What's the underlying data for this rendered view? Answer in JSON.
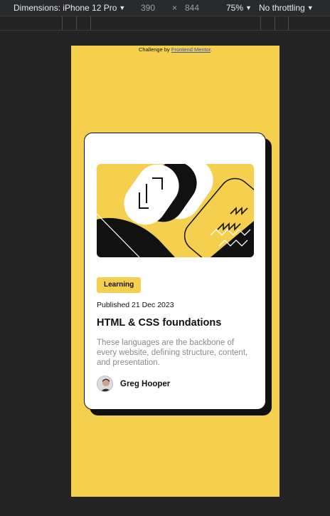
{
  "devtools": {
    "dimensions_label": "Dimensions: iPhone 12 Pro",
    "width": "390",
    "times": "×",
    "height": "844",
    "zoom": "75%",
    "throttling": "No throttling"
  },
  "attribution": {
    "prefix": "Challenge by",
    "link": "Frontend Mentor",
    "suffix": "."
  },
  "card": {
    "tag": "Learning",
    "published": "Published 21 Dec 2023",
    "title": "HTML & CSS foundations",
    "description": "These languages are the backbone of every website, defining structure, content, and presentation.",
    "author": "Greg Hooper"
  },
  "colors": {
    "yellow": "#f4d04e",
    "black": "#111111",
    "grey_text": "#8a8a8a"
  }
}
